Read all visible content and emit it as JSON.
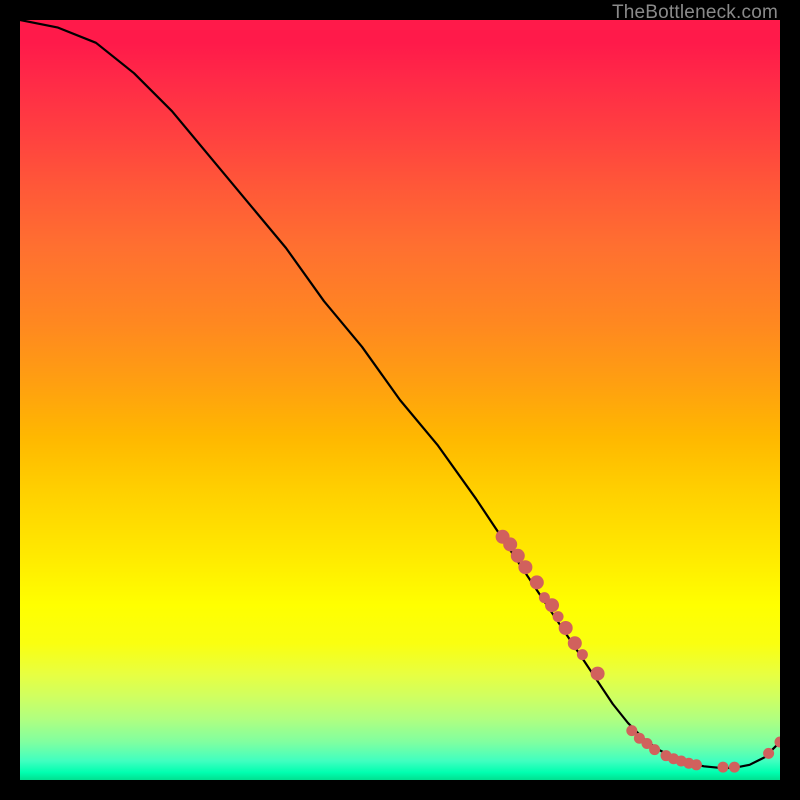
{
  "watermark": "TheBottleneck.com",
  "chart_data": {
    "type": "line",
    "title": "",
    "xlabel": "",
    "ylabel": "",
    "xlim": [
      0,
      100
    ],
    "ylim": [
      0,
      100
    ],
    "grid": false,
    "legend": false,
    "series": [
      {
        "name": "bottleneck-curve",
        "x": [
          0,
          5,
          10,
          15,
          20,
          25,
          30,
          35,
          40,
          45,
          50,
          55,
          60,
          62,
          64,
          66,
          68,
          70,
          72,
          74,
          76,
          78,
          80,
          82,
          84,
          86,
          88,
          90,
          92,
          94,
          96,
          98,
          100
        ],
        "y": [
          100,
          99,
          97,
          93,
          88,
          82,
          76,
          70,
          63,
          57,
          50,
          44,
          37,
          34,
          31,
          28,
          25,
          22,
          19,
          16,
          13,
          10,
          7.5,
          5.5,
          4,
          3,
          2.2,
          1.8,
          1.6,
          1.6,
          2,
          3,
          5
        ],
        "color": "#000000",
        "width": 2.2
      }
    ],
    "markers": {
      "name": "highlight-points",
      "color": "#d1615d",
      "radius_large": 7,
      "radius_small": 5.5,
      "points": [
        {
          "x": 63.5,
          "y": 32,
          "r": "large"
        },
        {
          "x": 64.5,
          "y": 31,
          "r": "large"
        },
        {
          "x": 65.5,
          "y": 29.5,
          "r": "large"
        },
        {
          "x": 66.5,
          "y": 28,
          "r": "large"
        },
        {
          "x": 68,
          "y": 26,
          "r": "large"
        },
        {
          "x": 69,
          "y": 24,
          "r": "small"
        },
        {
          "x": 70,
          "y": 23,
          "r": "large"
        },
        {
          "x": 70.8,
          "y": 21.5,
          "r": "small"
        },
        {
          "x": 71.8,
          "y": 20,
          "r": "large"
        },
        {
          "x": 73,
          "y": 18,
          "r": "large"
        },
        {
          "x": 74,
          "y": 16.5,
          "r": "small"
        },
        {
          "x": 76,
          "y": 14,
          "r": "large"
        },
        {
          "x": 80.5,
          "y": 6.5,
          "r": "small"
        },
        {
          "x": 81.5,
          "y": 5.5,
          "r": "small"
        },
        {
          "x": 82.5,
          "y": 4.8,
          "r": "small"
        },
        {
          "x": 83.5,
          "y": 4,
          "r": "small"
        },
        {
          "x": 85,
          "y": 3.2,
          "r": "small"
        },
        {
          "x": 86,
          "y": 2.8,
          "r": "small"
        },
        {
          "x": 87,
          "y": 2.5,
          "r": "small"
        },
        {
          "x": 88,
          "y": 2.2,
          "r": "small"
        },
        {
          "x": 89,
          "y": 2,
          "r": "small"
        },
        {
          "x": 92.5,
          "y": 1.7,
          "r": "small"
        },
        {
          "x": 94,
          "y": 1.7,
          "r": "small"
        },
        {
          "x": 98.5,
          "y": 3.5,
          "r": "small"
        },
        {
          "x": 100,
          "y": 5,
          "r": "small"
        }
      ]
    }
  }
}
